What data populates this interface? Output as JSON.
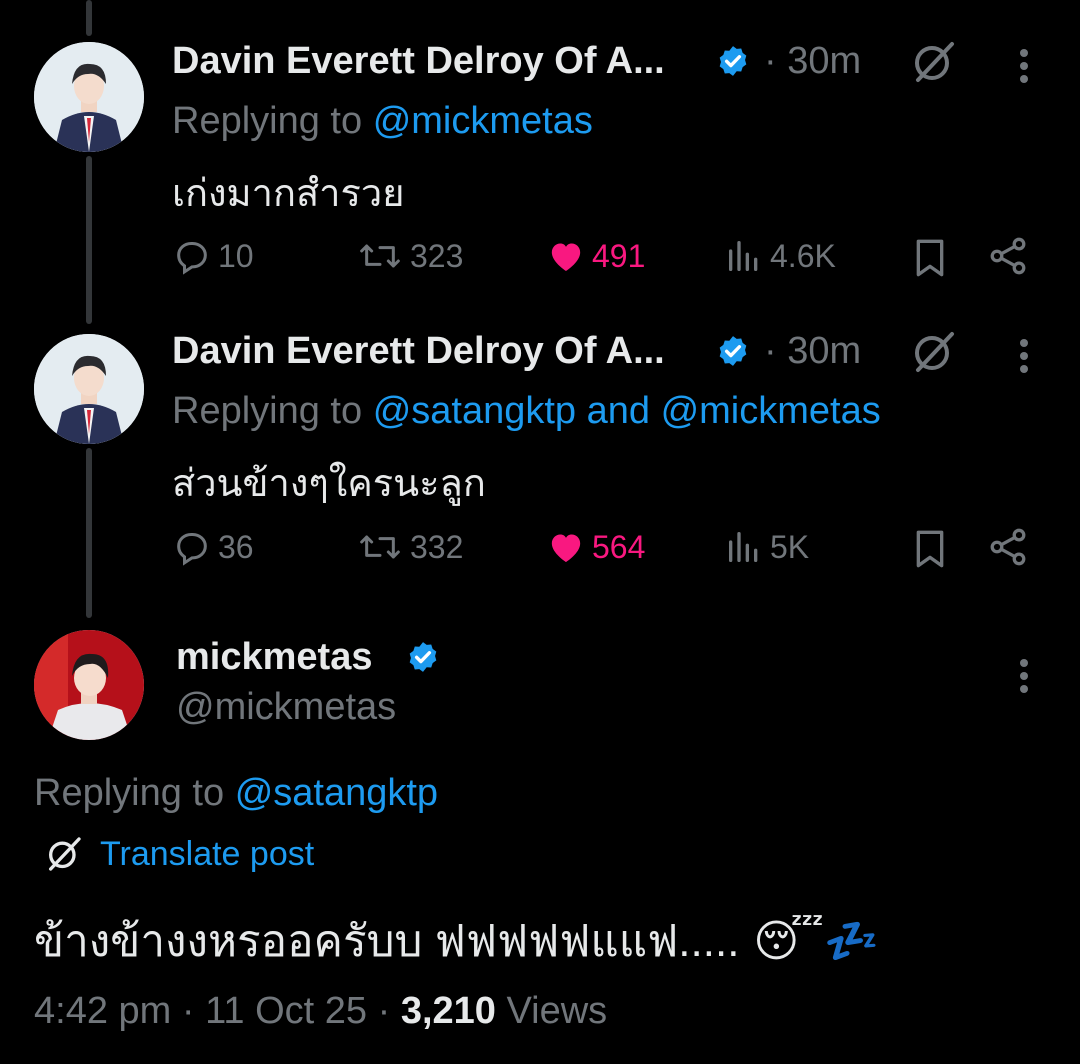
{
  "replies": [
    {
      "author_name": "Davin Everett Delroy Of A...",
      "time": "· 30m",
      "replying_label": "Replying to",
      "replying_to_1": "@mickmetas",
      "replying_and": "",
      "replying_to_2": "",
      "text": "เก่งมากสำรวย",
      "replies": "10",
      "reposts": "323",
      "likes": "491",
      "views": "4.6K",
      "icons": [
        "verified-badge-icon",
        "grok-icon",
        "more-icon",
        "reply-icon",
        "repost-icon",
        "heart-icon",
        "views-icon",
        "bookmark-icon",
        "share-icon"
      ]
    },
    {
      "author_name": "Davin Everett Delroy Of A...",
      "time": "· 30m",
      "replying_label": "Replying to",
      "replying_to_1": "@satangktp",
      "replying_and": "and",
      "replying_to_2": "@mickmetas",
      "text": "ส่วนข้างๆใครนะลูก",
      "replies": "36",
      "reposts": "332",
      "likes": "564",
      "views": "5K"
    }
  ],
  "main_post": {
    "author_name": "mickmetas",
    "handle": "@mickmetas",
    "replying_label": "Replying to",
    "replying_to": "@satangktp",
    "translate_label": "Translate post",
    "text": "ข้างข้างงหรออครับบ ฟฟฟฟฟแแฟ.....",
    "emoji": "😴💤",
    "time": "4:42 pm",
    "date": "11 Oct 25",
    "views_count": "3,210",
    "views_label": "Views"
  },
  "colors": {
    "background": "#000000",
    "text": "#e7e9ea",
    "muted": "#71767b",
    "link": "#1d9bf0",
    "like": "#f91880",
    "verified": "#1d9bf0"
  }
}
